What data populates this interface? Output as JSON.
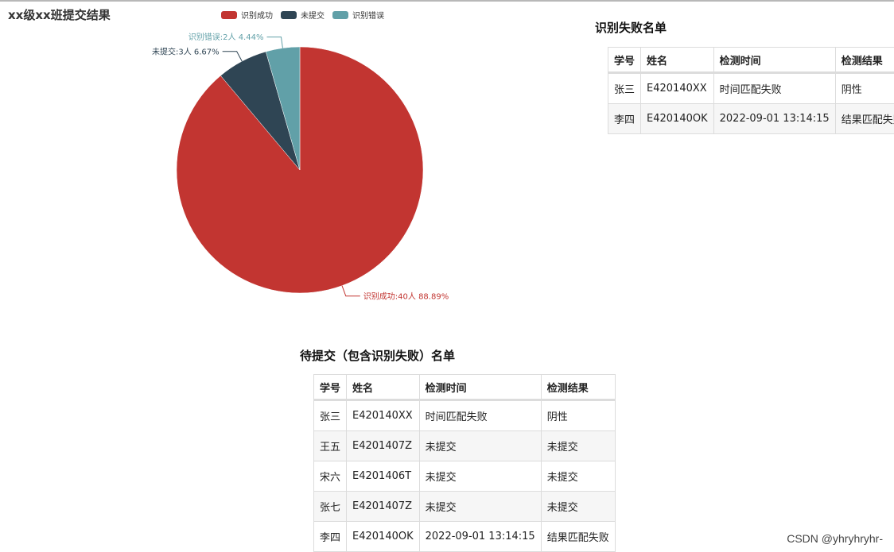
{
  "chart_data": {
    "type": "pie",
    "title": "xx级xx班提交结果",
    "legend_position": "top",
    "slices": [
      {
        "name": "识别成功",
        "value": 40,
        "percent": 88.89,
        "label": "识别成功:40人 88.89%",
        "color": "#c23531"
      },
      {
        "name": "未提交",
        "value": 3,
        "percent": 6.67,
        "label": "未提交:3人 6.67%",
        "color": "#2f4554"
      },
      {
        "name": "识别错误",
        "value": 2,
        "percent": 4.44,
        "label": "识别错误:2人 4.44%",
        "color": "#61a0a8"
      }
    ]
  },
  "failed_section": {
    "title": "识别失败名单",
    "headers": [
      "学号",
      "姓名",
      "检测时间",
      "检测结果"
    ],
    "rows": [
      [
        "张三",
        "E420140XX",
        "时间匹配失败",
        "阴性"
      ],
      [
        "李四",
        "E420140OK",
        "2022-09-01 13:14:15",
        "结果匹配失败"
      ]
    ]
  },
  "pending_section": {
    "title": "待提交（包含识别失败）名单",
    "headers": [
      "学号",
      "姓名",
      "检测时间",
      "检测结果"
    ],
    "rows": [
      [
        "张三",
        "E420140XX",
        "时间匹配失败",
        "阴性"
      ],
      [
        "王五",
        "E4201407Z",
        "未提交",
        "未提交"
      ],
      [
        "宋六",
        "E4201406T",
        "未提交",
        "未提交"
      ],
      [
        "张七",
        "E4201407Z",
        "未提交",
        "未提交"
      ],
      [
        "李四",
        "E420140OK",
        "2022-09-01 13:14:15",
        "结果匹配失败"
      ]
    ]
  },
  "watermark": "CSDN @yhryhryhr-"
}
